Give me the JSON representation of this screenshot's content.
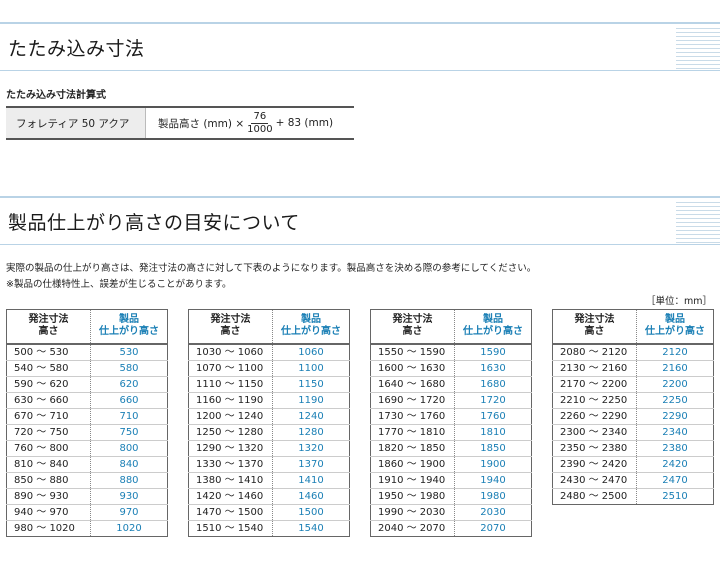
{
  "section1": {
    "title": "たたみ込み寸法"
  },
  "formula": {
    "heading": "たたみ込み寸法計算式",
    "product": "フォレティア 50 アクア",
    "prefix": "製品高さ (mm) ×",
    "numerator": "76",
    "denominator": "1000",
    "suffix": "+ 83 (mm)"
  },
  "section2": {
    "title": "製品仕上がり高さの目安について"
  },
  "notes": {
    "line1": "実際の製品の仕上がり高さは、発注寸法の高さに対して下表のようになります。製品高さを決める際の参考にしてください。",
    "line2": "※製品の仕様特性上、誤差が生じることがあります。"
  },
  "unit_label": "［単位：mm］",
  "table_headers": {
    "col1_line1": "発注寸法",
    "col1_line2": "高さ",
    "col2_line1": "製品",
    "col2_line2": "仕上がり高さ"
  },
  "tables": [
    {
      "rows": [
        {
          "range": "500 ～  530",
          "value": "530"
        },
        {
          "range": "540 ～  580",
          "value": "580"
        },
        {
          "range": "590 ～  620",
          "value": "620"
        },
        {
          "range": "630 ～  660",
          "value": "660"
        },
        {
          "range": "670 ～  710",
          "value": "710"
        },
        {
          "range": "720 ～  750",
          "value": "750"
        },
        {
          "range": "760 ～  800",
          "value": "800"
        },
        {
          "range": "810 ～  840",
          "value": "840"
        },
        {
          "range": "850 ～  880",
          "value": "880"
        },
        {
          "range": "890 ～  930",
          "value": "930"
        },
        {
          "range": "940 ～  970",
          "value": "970"
        },
        {
          "range": "980 ～ 1020",
          "value": "1020"
        }
      ]
    },
    {
      "rows": [
        {
          "range": "1030 ～ 1060",
          "value": "1060"
        },
        {
          "range": "1070 ～ 1100",
          "value": "1100"
        },
        {
          "range": "1110 ～ 1150",
          "value": "1150"
        },
        {
          "range": "1160 ～ 1190",
          "value": "1190"
        },
        {
          "range": "1200 ～ 1240",
          "value": "1240"
        },
        {
          "range": "1250 ～ 1280",
          "value": "1280"
        },
        {
          "range": "1290 ～ 1320",
          "value": "1320"
        },
        {
          "range": "1330 ～ 1370",
          "value": "1370"
        },
        {
          "range": "1380 ～ 1410",
          "value": "1410"
        },
        {
          "range": "1420 ～ 1460",
          "value": "1460"
        },
        {
          "range": "1470 ～ 1500",
          "value": "1500"
        },
        {
          "range": "1510 ～ 1540",
          "value": "1540"
        }
      ]
    },
    {
      "rows": [
        {
          "range": "1550 ～ 1590",
          "value": "1590"
        },
        {
          "range": "1600 ～ 1630",
          "value": "1630"
        },
        {
          "range": "1640 ～ 1680",
          "value": "1680"
        },
        {
          "range": "1690 ～ 1720",
          "value": "1720"
        },
        {
          "range": "1730 ～ 1760",
          "value": "1760"
        },
        {
          "range": "1770 ～ 1810",
          "value": "1810"
        },
        {
          "range": "1820 ～ 1850",
          "value": "1850"
        },
        {
          "range": "1860 ～ 1900",
          "value": "1900"
        },
        {
          "range": "1910 ～ 1940",
          "value": "1940"
        },
        {
          "range": "1950 ～ 1980",
          "value": "1980"
        },
        {
          "range": "1990 ～ 2030",
          "value": "2030"
        },
        {
          "range": "2040 ～ 2070",
          "value": "2070"
        }
      ]
    },
    {
      "rows": [
        {
          "range": "2080 ～ 2120",
          "value": "2120"
        },
        {
          "range": "2130 ～ 2160",
          "value": "2160"
        },
        {
          "range": "2170 ～ 2200",
          "value": "2200"
        },
        {
          "range": "2210 ～ 2250",
          "value": "2250"
        },
        {
          "range": "2260 ～ 2290",
          "value": "2290"
        },
        {
          "range": "2300 ～ 2340",
          "value": "2340"
        },
        {
          "range": "2350 ～ 2380",
          "value": "2380"
        },
        {
          "range": "2390 ～ 2420",
          "value": "2420"
        },
        {
          "range": "2430 ～ 2470",
          "value": "2470"
        },
        {
          "range": "2480 ～ 2500",
          "value": "2510"
        }
      ]
    }
  ]
}
